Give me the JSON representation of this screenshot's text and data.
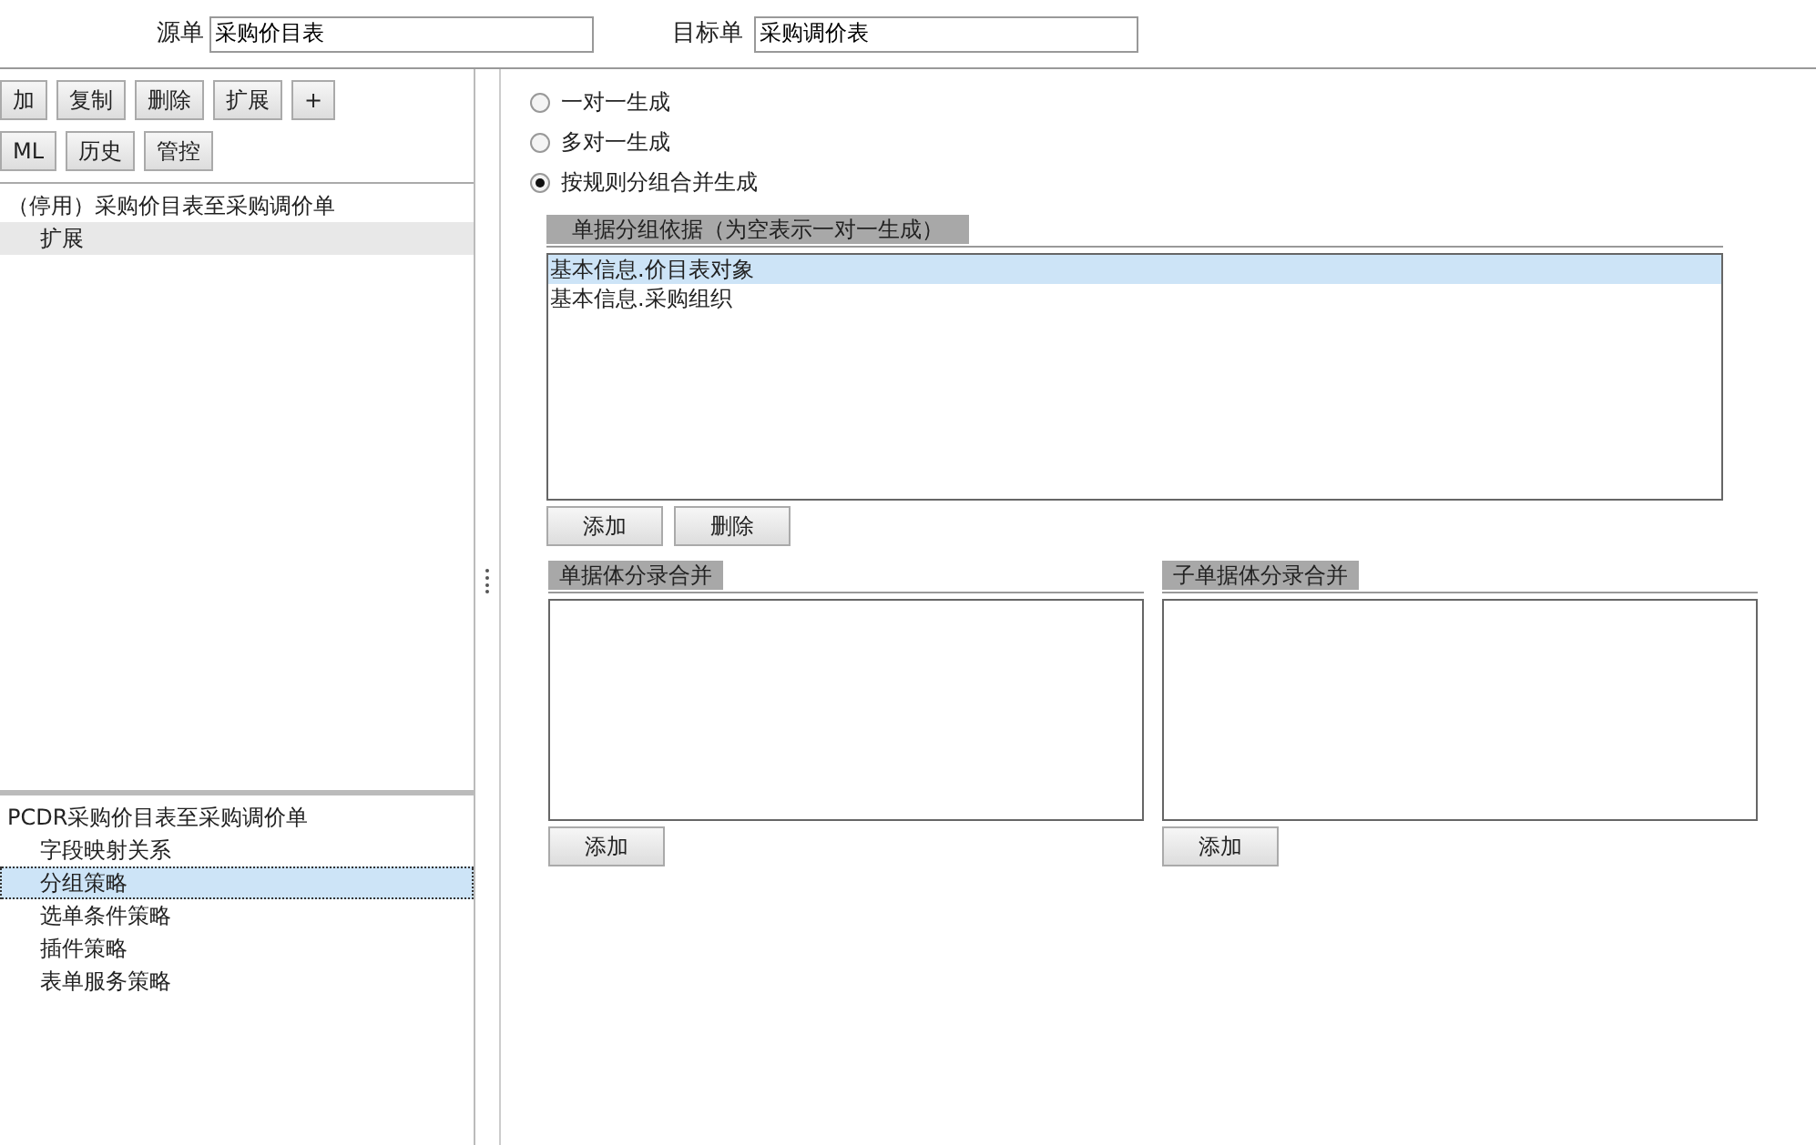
{
  "header": {
    "source_label": "源单",
    "source_value": "采购价目表",
    "target_label": "目标单",
    "target_value": "采购调价表"
  },
  "toolbar_rows": [
    [
      "加",
      "复制",
      "删除",
      "扩展",
      "+"
    ],
    [
      "ML",
      "历史",
      "管控"
    ]
  ],
  "rule_tree": [
    {
      "label": "（停用）采购价目表至采购调价单",
      "selected": false,
      "children": [
        {
          "label": "扩展",
          "selected": true
        }
      ]
    }
  ],
  "strategy_tree": [
    {
      "label": "PCDR采购价目表至采购调价单",
      "selected": false,
      "children": [
        {
          "label": "字段映射关系",
          "selected": false
        },
        {
          "label": "分组策略",
          "selected": true
        },
        {
          "label": "选单条件策略",
          "selected": false
        },
        {
          "label": "插件策略",
          "selected": false
        },
        {
          "label": "表单服务策略",
          "selected": false
        }
      ]
    }
  ],
  "modes": [
    {
      "label": "一对一生成",
      "selected": false
    },
    {
      "label": "多对一生成",
      "selected": false
    },
    {
      "label": "按规则分组合并生成",
      "selected": true
    }
  ],
  "group_basis": {
    "title": "单据分组依据（为空表示一对一生成）",
    "items": [
      {
        "label": "基本信息.价目表对象",
        "selected": true
      },
      {
        "label": "基本信息.采购组织",
        "selected": false
      }
    ],
    "buttons": [
      "添加",
      "删除"
    ]
  },
  "merge_panels": [
    {
      "title": "单据体分录合并",
      "buttons": [
        "添加"
      ]
    },
    {
      "title": "子单据体分录合并",
      "buttons": [
        "添加"
      ]
    }
  ]
}
